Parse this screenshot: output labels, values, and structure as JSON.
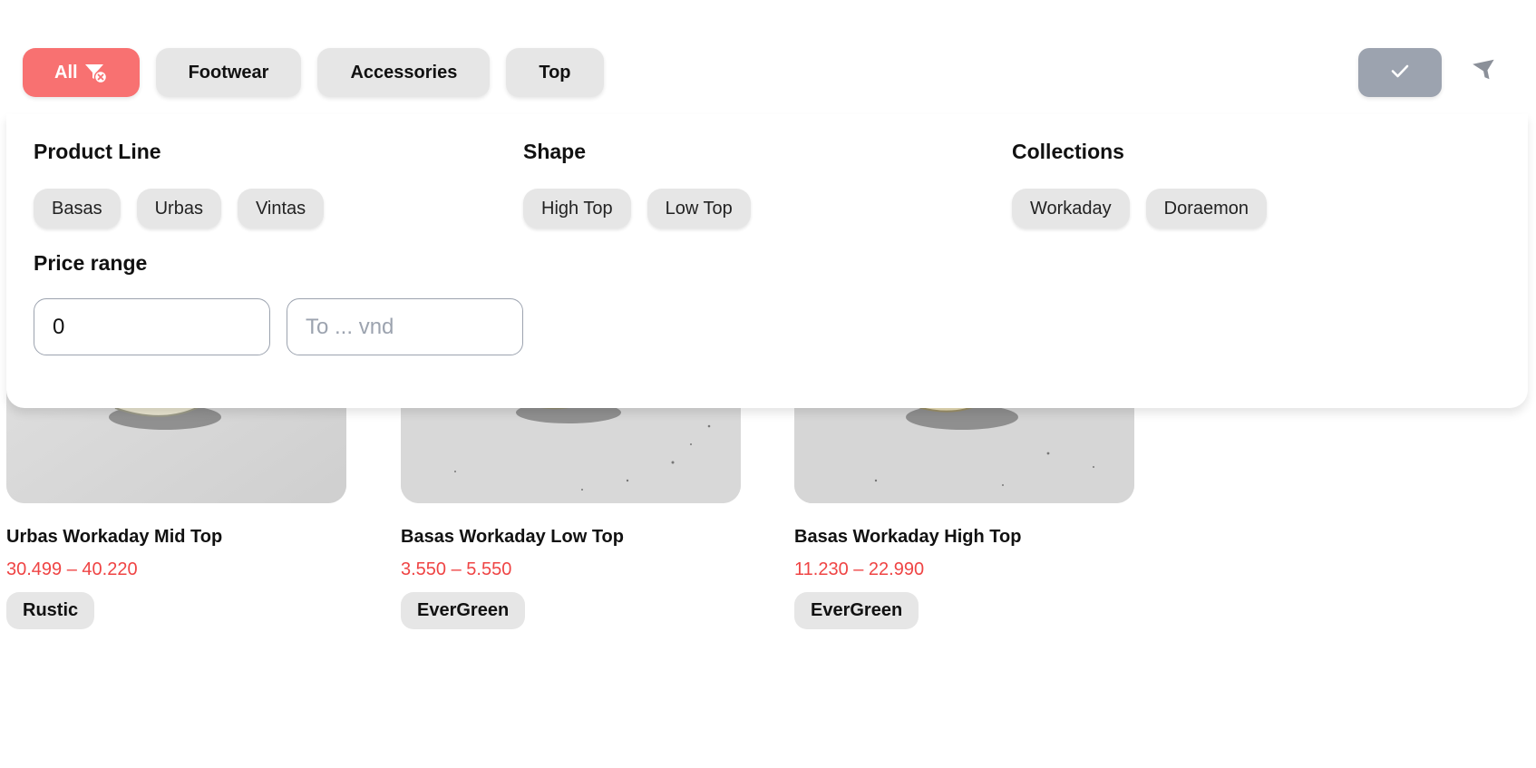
{
  "categories": {
    "all_label": "All",
    "items": [
      "Footwear",
      "Accessories",
      "Top"
    ]
  },
  "filter_panel": {
    "product_line": {
      "title": "Product Line",
      "options": [
        "Basas",
        "Urbas",
        "Vintas"
      ]
    },
    "shape": {
      "title": "Shape",
      "options": [
        "High Top",
        "Low Top"
      ]
    },
    "collections": {
      "title": "Collections",
      "options": [
        "Workaday",
        "Doraemon"
      ]
    },
    "price_range": {
      "title": "Price range",
      "from_value": "0",
      "to_placeholder": "To ... vnd"
    }
  },
  "products": [
    {
      "name": "Urbas Workaday Mid Top",
      "price": "30.499 – 40.220",
      "tag": "Rustic"
    },
    {
      "name": "Basas Workaday Low Top",
      "price": "3.550 – 5.550",
      "tag": "EverGreen"
    },
    {
      "name": "Basas Workaday High Top",
      "price": "11.230 – 22.990",
      "tag": "EverGreen"
    }
  ],
  "colors": {
    "accent": "#f87171",
    "price": "#ef4444",
    "chip_bg": "#e6e6e6",
    "apply_bg": "#9ca3af"
  },
  "icons": {
    "all_button": "filter-clear-icon",
    "apply_button": "check-icon",
    "filter_toggle": "funnel-icon"
  }
}
